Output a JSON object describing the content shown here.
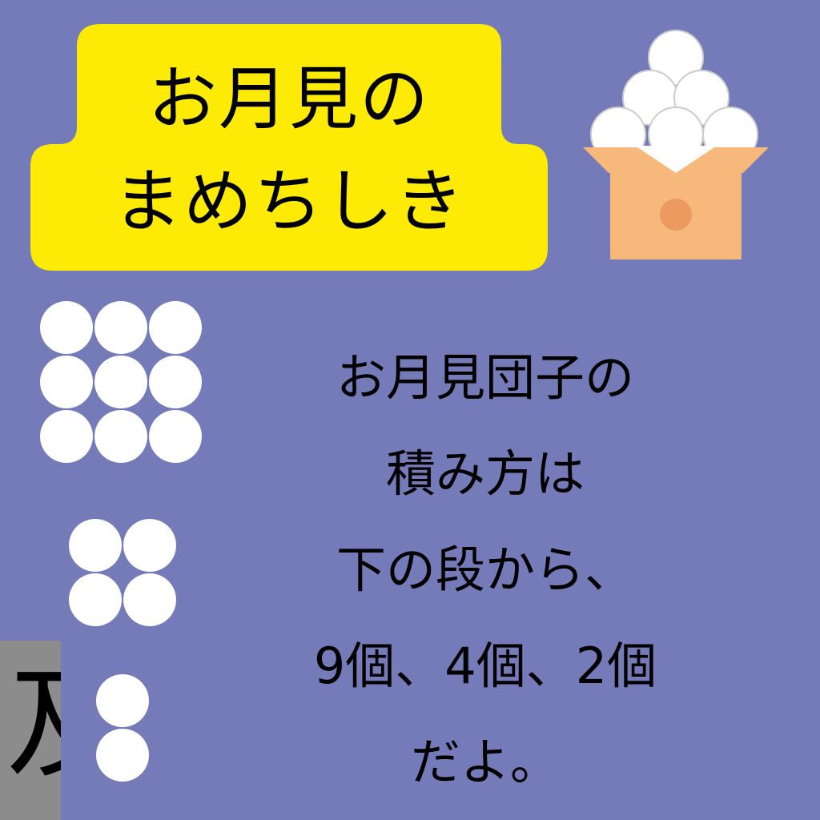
{
  "title": {
    "line1": "お月見の",
    "line2": "まめちしき"
  },
  "body": {
    "lines": [
      "お月見団子の",
      "積み方は",
      "下の段から、",
      "9個、4個、2個",
      "だよ。"
    ]
  },
  "edge_fragment": "及",
  "dango_counts": [
    9,
    4,
    2
  ],
  "colors": {
    "background": "#757bb9",
    "title_box": "#fdeb05",
    "dango": "#ffffff",
    "sanbo_body": "#f7b87c",
    "sanbo_knot": "#ec9a60",
    "edge_strip": "#8c8c8c"
  },
  "icons": [
    "tsukimi-dango-icon"
  ]
}
